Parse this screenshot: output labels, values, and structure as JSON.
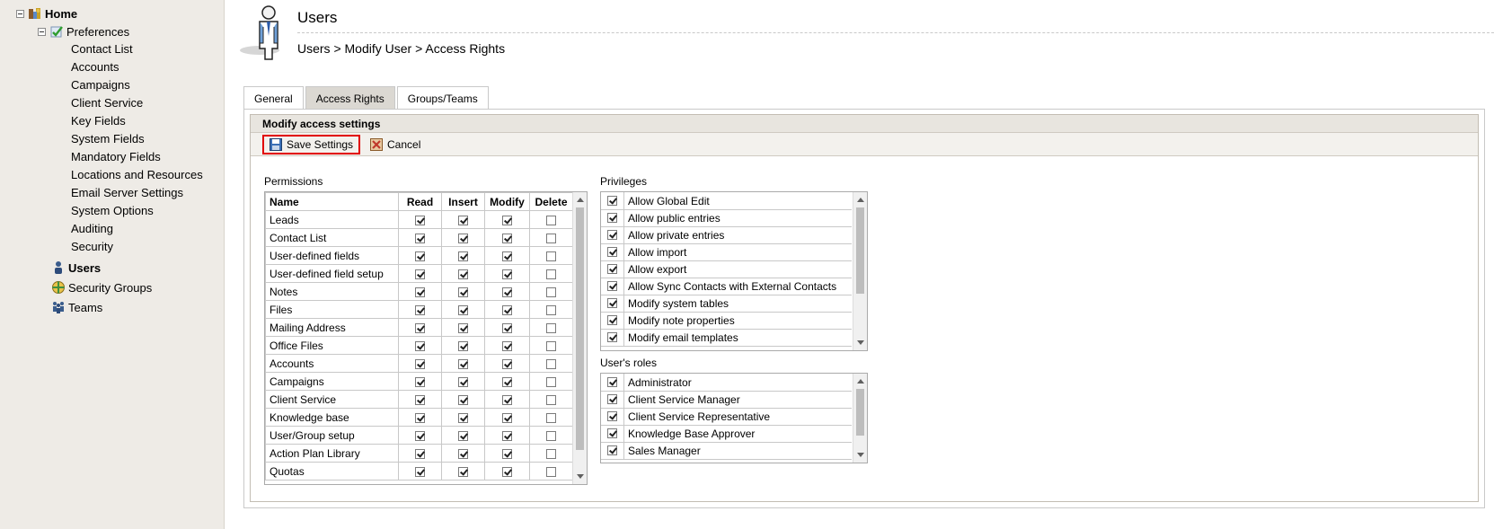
{
  "sidebar": {
    "home": "Home",
    "preferences": "Preferences",
    "pref_items": [
      "Contact List",
      "Accounts",
      "Campaigns",
      "Client Service",
      "Key Fields",
      "System Fields",
      "Mandatory Fields",
      "Locations and Resources",
      "Email Server Settings",
      "System Options",
      "Auditing",
      "Security"
    ],
    "users": "Users",
    "security_groups": "Security Groups",
    "teams": "Teams"
  },
  "header": {
    "title": "Users",
    "breadcrumb": "Users > Modify User > Access Rights"
  },
  "tabs": [
    "General",
    "Access Rights",
    "Groups/Teams"
  ],
  "active_tab": "Access Rights",
  "panel": {
    "heading": "Modify access settings",
    "save_label": "Save Settings",
    "cancel_label": "Cancel"
  },
  "permissions": {
    "label": "Permissions",
    "columns": [
      "Name",
      "Read",
      "Insert",
      "Modify",
      "Delete"
    ],
    "rows": [
      {
        "name": "Leads",
        "read": true,
        "insert": true,
        "modify": true,
        "delete": false
      },
      {
        "name": "Contact List",
        "read": true,
        "insert": true,
        "modify": true,
        "delete": false
      },
      {
        "name": "User-defined fields",
        "read": true,
        "insert": true,
        "modify": true,
        "delete": false
      },
      {
        "name": "User-defined field setup",
        "read": true,
        "insert": true,
        "modify": true,
        "delete": false
      },
      {
        "name": "Notes",
        "read": true,
        "insert": true,
        "modify": true,
        "delete": false
      },
      {
        "name": "Files",
        "read": true,
        "insert": true,
        "modify": true,
        "delete": false
      },
      {
        "name": "Mailing Address",
        "read": true,
        "insert": true,
        "modify": true,
        "delete": false
      },
      {
        "name": "Office Files",
        "read": true,
        "insert": true,
        "modify": true,
        "delete": false
      },
      {
        "name": "Accounts",
        "read": true,
        "insert": true,
        "modify": true,
        "delete": false
      },
      {
        "name": "Campaigns",
        "read": true,
        "insert": true,
        "modify": true,
        "delete": false
      },
      {
        "name": "Client Service",
        "read": true,
        "insert": true,
        "modify": true,
        "delete": false
      },
      {
        "name": "Knowledge base",
        "read": true,
        "insert": true,
        "modify": true,
        "delete": false
      },
      {
        "name": "User/Group setup",
        "read": true,
        "insert": true,
        "modify": true,
        "delete": false
      },
      {
        "name": "Action Plan Library",
        "read": true,
        "insert": true,
        "modify": true,
        "delete": false
      },
      {
        "name": "Quotas",
        "read": true,
        "insert": true,
        "modify": true,
        "delete": false
      }
    ]
  },
  "privileges": {
    "label": "Privileges",
    "items": [
      {
        "label": "Allow Global Edit",
        "checked": true
      },
      {
        "label": "Allow public entries",
        "checked": true
      },
      {
        "label": "Allow private entries",
        "checked": true
      },
      {
        "label": "Allow import",
        "checked": true
      },
      {
        "label": "Allow export",
        "checked": true
      },
      {
        "label": "Allow Sync Contacts with External Contacts",
        "checked": true
      },
      {
        "label": "Modify system tables",
        "checked": true
      },
      {
        "label": "Modify note properties",
        "checked": true
      },
      {
        "label": "Modify email templates",
        "checked": true
      }
    ]
  },
  "roles": {
    "label": "User's roles",
    "items": [
      {
        "label": "Administrator",
        "checked": true
      },
      {
        "label": "Client Service Manager",
        "checked": true
      },
      {
        "label": "Client Service Representative",
        "checked": true
      },
      {
        "label": "Knowledge Base Approver",
        "checked": true
      },
      {
        "label": "Sales Manager",
        "checked": true
      }
    ]
  },
  "colors": {
    "sidebar_bg": "#eeebe6",
    "highlight_border": "#e10000",
    "active_tab_bg": "#dbd8d2"
  }
}
